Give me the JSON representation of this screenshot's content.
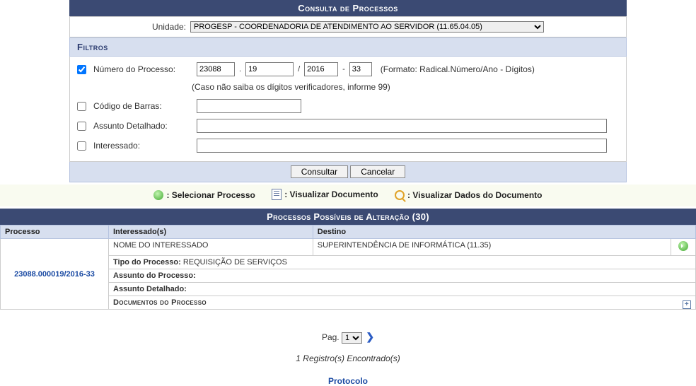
{
  "header": {
    "title": "Consulta de Processos"
  },
  "unidade": {
    "label": "Unidade:",
    "value": "PROGESP - COORDENADORIA DE ATENDIMENTO AO SERVIDOR (11.65.04.05)"
  },
  "filtros": {
    "title": "Filtros",
    "numero_processo": {
      "label": "Número do Processo:",
      "checked": true,
      "radical": "23088",
      "numero": "19",
      "ano": "2016",
      "digitos": "33",
      "format_hint": "(Formato: Radical.Número/Ano - Dígitos)",
      "sub_hint": "(Caso não saiba os dígitos verificadores, informe 99)"
    },
    "codigo_barras": {
      "label": "Código de Barras:",
      "value": ""
    },
    "assunto_detalhado": {
      "label": "Assunto Detalhado:",
      "value": ""
    },
    "interessado": {
      "label": "Interessado:",
      "value": ""
    },
    "btn_consultar": "Consultar",
    "btn_cancelar": "Cancelar"
  },
  "legend": {
    "select": ": Selecionar Processo",
    "view_doc": ": Visualizar Documento",
    "view_data": ": Visualizar Dados do Documento"
  },
  "results": {
    "section_title": "Processos Possíveis de Alteração (30)",
    "cols": {
      "processo": "Processo",
      "interessados": "Interessado(s)",
      "destino": "Destino"
    },
    "row": {
      "processo_link": "23088.000019/2016-33",
      "interessado": "NOME DO INTERESSADO",
      "destino": "SUPERINTENDÊNCIA DE INFORMÁTICA (11.35)",
      "tipo_label": "Tipo do Processo:",
      "tipo_value": "REQUISIÇÃO DE SERVIÇOS",
      "assunto_processo_label": "Assunto do Processo:",
      "assunto_detalhado_label": "Assunto Detalhado:",
      "docs_title": "Documentos do Processo"
    }
  },
  "pager": {
    "label_prefix": "Pag.",
    "current": "1"
  },
  "result_count": "1 Registro(s) Encontrado(s)",
  "footer_link": "Protocolo"
}
